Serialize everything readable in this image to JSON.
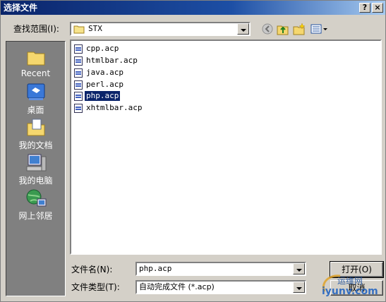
{
  "window": {
    "title": "选择文件",
    "help_label": "?",
    "close_label": "×"
  },
  "lookin": {
    "label": "查找范围(I):",
    "value": "STX"
  },
  "toolbar": {
    "back_icon": "back-icon",
    "up_icon": "up-folder-icon",
    "new_folder_icon": "new-folder-icon",
    "view_icon": "view-menu-icon"
  },
  "sidebar": {
    "items": [
      {
        "label": "Recent",
        "icon": "recent-folder-icon"
      },
      {
        "label": "桌面",
        "icon": "desktop-icon"
      },
      {
        "label": "我的文档",
        "icon": "my-documents-icon"
      },
      {
        "label": "我的电脑",
        "icon": "my-computer-icon"
      },
      {
        "label": "网上邻居",
        "icon": "network-icon"
      }
    ]
  },
  "files": [
    {
      "name": "cpp.acp",
      "selected": false
    },
    {
      "name": "htmlbar.acp",
      "selected": false
    },
    {
      "name": "java.acp",
      "selected": false
    },
    {
      "name": "perl.acp",
      "selected": false
    },
    {
      "name": "php.acp",
      "selected": true
    },
    {
      "name": "xhtmlbar.acp",
      "selected": false
    }
  ],
  "filename": {
    "label": "文件名(N):",
    "value": "php.acp"
  },
  "filetype": {
    "label": "文件类型(T):",
    "value": "自动完成文件 (*.acp)"
  },
  "buttons": {
    "open": "打开(O)",
    "cancel": "取消"
  },
  "watermark": {
    "top": "运维网",
    "bottom": "iyunv.com"
  }
}
